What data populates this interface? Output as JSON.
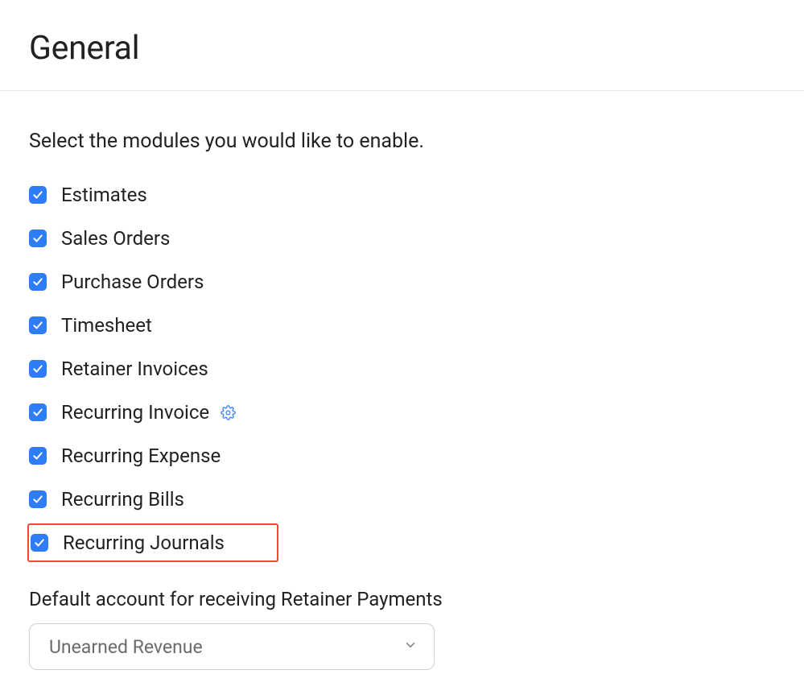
{
  "header": {
    "title": "General"
  },
  "intro": "Select the modules you would like to enable.",
  "modules": {
    "items": [
      {
        "label": "Estimates",
        "checked": true,
        "settings": false,
        "highlighted": false
      },
      {
        "label": "Sales Orders",
        "checked": true,
        "settings": false,
        "highlighted": false
      },
      {
        "label": "Purchase Orders",
        "checked": true,
        "settings": false,
        "highlighted": false
      },
      {
        "label": "Timesheet",
        "checked": true,
        "settings": false,
        "highlighted": false
      },
      {
        "label": "Retainer Invoices",
        "checked": true,
        "settings": false,
        "highlighted": false
      },
      {
        "label": "Recurring Invoice",
        "checked": true,
        "settings": true,
        "highlighted": false
      },
      {
        "label": "Recurring Expense",
        "checked": true,
        "settings": false,
        "highlighted": false
      },
      {
        "label": "Recurring Bills",
        "checked": true,
        "settings": false,
        "highlighted": false
      },
      {
        "label": "Recurring Journals",
        "checked": true,
        "settings": false,
        "highlighted": true
      }
    ]
  },
  "default_account": {
    "label": "Default account for receiving Retainer Payments",
    "value": "Unearned Revenue"
  }
}
